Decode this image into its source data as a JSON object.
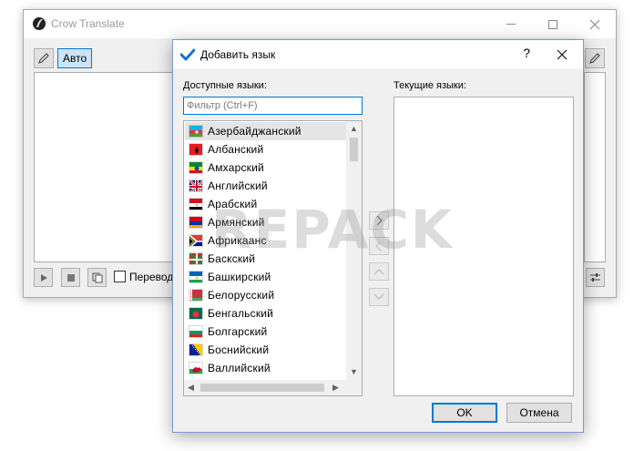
{
  "main_window": {
    "title": "Crow Translate",
    "source_lang_button": "Авто",
    "checkbox_label": "Переводи"
  },
  "dialog": {
    "title": "Добавить язык",
    "help": "?",
    "available_label": "Доступные языки:",
    "current_label": "Текущие языки:",
    "filter_placeholder": "Фильтр (Ctrl+F)",
    "filter_value": "",
    "languages": [
      {
        "label": "Азербайджанский",
        "icon": "azerbaijan-flag",
        "selected": true
      },
      {
        "label": "Албанский",
        "icon": "albania-flag"
      },
      {
        "label": "Амхарский",
        "icon": "ethiopia-flag"
      },
      {
        "label": "Английский",
        "icon": "uk-flag"
      },
      {
        "label": "Арабский",
        "icon": "egypt-flag"
      },
      {
        "label": "Армянский",
        "icon": "armenia-flag"
      },
      {
        "label": "Африкаанс",
        "icon": "south-africa-flag"
      },
      {
        "label": "Баскский",
        "icon": "basque-flag"
      },
      {
        "label": "Башкирский",
        "icon": "bashkortostan-flag"
      },
      {
        "label": "Белорусский",
        "icon": "belarus-flag"
      },
      {
        "label": "Бенгальский",
        "icon": "bangladesh-flag"
      },
      {
        "label": "Болгарский",
        "icon": "bulgaria-flag"
      },
      {
        "label": "Боснийский",
        "icon": "bosnia-flag"
      },
      {
        "label": "Валлийский",
        "icon": "wales-flag"
      }
    ],
    "current_languages": [],
    "ok_label": "OK",
    "cancel_label": "Отмена"
  },
  "watermark": "REPACK",
  "colors": {
    "accent": "#0078d7",
    "selection": "#e5e5e5"
  }
}
